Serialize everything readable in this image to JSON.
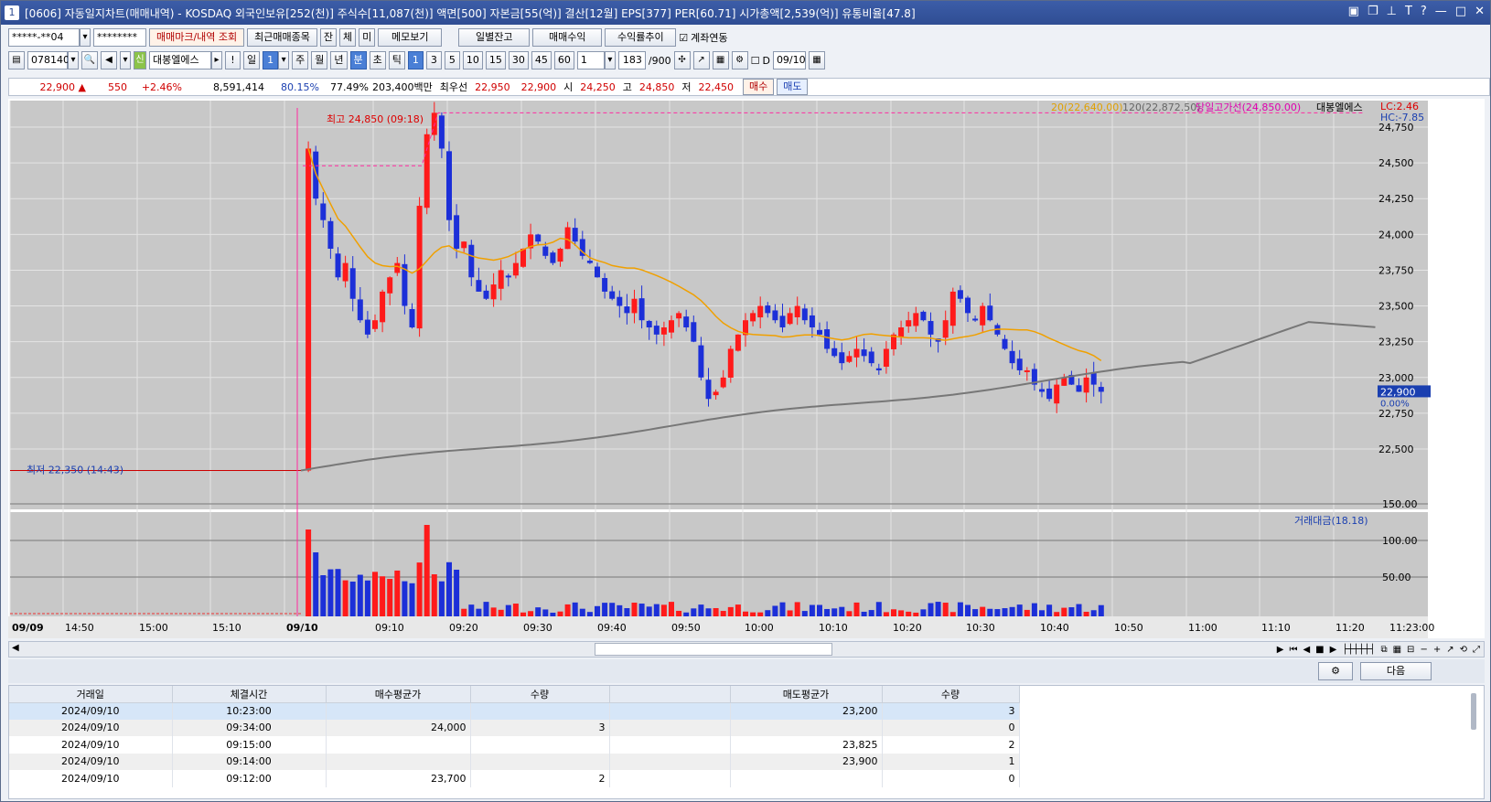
{
  "title": "[0606] 자동일지차트(매매내역) - KOSDAQ 외국인보유[252(천)] 주식수[11,087(천)] 액면[500] 자본금[55(억)] 결산[12월] EPS[377] PER[60.71] 시가총액[2,539(억)] 유통비율[47.8]",
  "toolbar1": {
    "account": "*****-**04",
    "password": "********",
    "b1": "매매마크/내역 조회",
    "b2": "최근매매종목",
    "b3": "잔",
    "b4": "체",
    "b5": "미",
    "b6": "메모보기",
    "b7": "일별잔고",
    "b8": "매매수익",
    "b9": "수익률추이",
    "check": "계좌연동"
  },
  "toolbar2": {
    "code": "078140",
    "credit": "신",
    "name": "대봉엘에스",
    "excl": "!",
    "p1": "일",
    "p1v": "1",
    "p2": "주",
    "p3": "월",
    "p4": "년",
    "p5": "분",
    "p6": "초",
    "p7": "틱",
    "min": [
      "1",
      "3",
      "5",
      "10",
      "15",
      "30",
      "45",
      "60"
    ],
    "cnt": "1",
    "shown": "183",
    "total": "/900",
    "d": "D",
    "date": "09/10"
  },
  "price": {
    "current": "22,900",
    "arrow": "▲",
    "change": "550",
    "rate": "+2.46%",
    "volume": "8,591,414",
    "vr": "80.15%",
    "vr2": "77.49%",
    "amount": "203,400백만",
    "best_label": "최우선",
    "bid1": "22,950",
    "ask1": "22,900",
    "open_l": "시",
    "open": "24,250",
    "high_l": "고",
    "high": "24,850",
    "low_l": "저",
    "low": "22,450",
    "buy": "매수",
    "sell": "매도"
  },
  "chart_labels": {
    "ma20": "20(22,640.00)",
    "ma120": "120(22,872.50)",
    "dayhigh": "당일고가선(24,850.00)",
    "stock": "대봉엘에스",
    "lc": "LC:2.46",
    "hc": "HC:-7.85",
    "maxl": "최고 24,850 (09:18)",
    "minl": "최저 22,350 (14:43)",
    "curr": "22,900",
    "currpct": "0.00%",
    "vol_legend": "거래대금(18.18)",
    "endtime": "11:23:00"
  },
  "chart_data": {
    "type": "candlestick",
    "y_ticks": [
      "24,750",
      "24,500",
      "24,250",
      "24,000",
      "23,750",
      "23,500",
      "23,250",
      "23,000",
      "22,750",
      "22,500"
    ],
    "vol_ticks": [
      "150.00",
      "100.00",
      "50.00"
    ],
    "x_ticks": [
      "09/09",
      "14:50",
      "15:00",
      "15:10",
      "09/10",
      "09:10",
      "09:20",
      "09:30",
      "09:40",
      "09:50",
      "10:00",
      "10:10",
      "10:20",
      "10:30",
      "10:40",
      "10:50",
      "11:00",
      "11:10",
      "11:20"
    ],
    "high": 24850,
    "low": 22350,
    "close": 22900
  },
  "table": {
    "headers": [
      "거래일",
      "체결시간",
      "매수평균가",
      "수량",
      "",
      "매도평균가",
      "수량"
    ],
    "rows": [
      [
        "2024/09/10",
        "10:23:00",
        "",
        "",
        "",
        "23,200",
        "3"
      ],
      [
        "2024/09/10",
        "09:34:00",
        "24,000",
        "3",
        "",
        "",
        "0"
      ],
      [
        "2024/09/10",
        "09:15:00",
        "",
        "",
        "",
        "23,825",
        "2"
      ],
      [
        "2024/09/10",
        "09:14:00",
        "",
        "",
        "",
        "23,900",
        "1"
      ],
      [
        "2024/09/10",
        "09:12:00",
        "23,700",
        "2",
        "",
        "",
        "0"
      ]
    ]
  },
  "next": "다음"
}
